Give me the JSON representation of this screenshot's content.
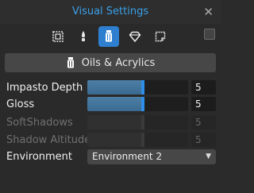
{
  "window": {
    "title": "Visual Settings",
    "close_glyph": "✕"
  },
  "toolbar": {
    "tools": [
      {
        "icon": "frame-icon",
        "active": false
      },
      {
        "icon": "brush-icon",
        "active": false
      },
      {
        "icon": "paint-tube-icon",
        "active": true
      },
      {
        "icon": "gem-icon",
        "active": false
      },
      {
        "icon": "canvas-icon",
        "active": false
      }
    ],
    "accent": "#2f7fd0"
  },
  "preset": {
    "label": "Oils & Acrylics",
    "icon": "paint-tube-icon"
  },
  "settings": [
    {
      "label": "Impasto Depth",
      "value": "5",
      "level": 0.55,
      "enabled": true
    },
    {
      "label": "Gloss",
      "value": "5",
      "level": 0.55,
      "enabled": true
    },
    {
      "label": "SoftShadows",
      "value": "5",
      "level": 0.55,
      "enabled": false
    },
    {
      "label": "Shadow Altitude",
      "value": "5",
      "level": 0.55,
      "enabled": false
    }
  ],
  "environment": {
    "label": "Environment",
    "selected": "Environment 2"
  },
  "colors": {
    "title": "#3aa0e8",
    "background": "#2a2a2a"
  }
}
